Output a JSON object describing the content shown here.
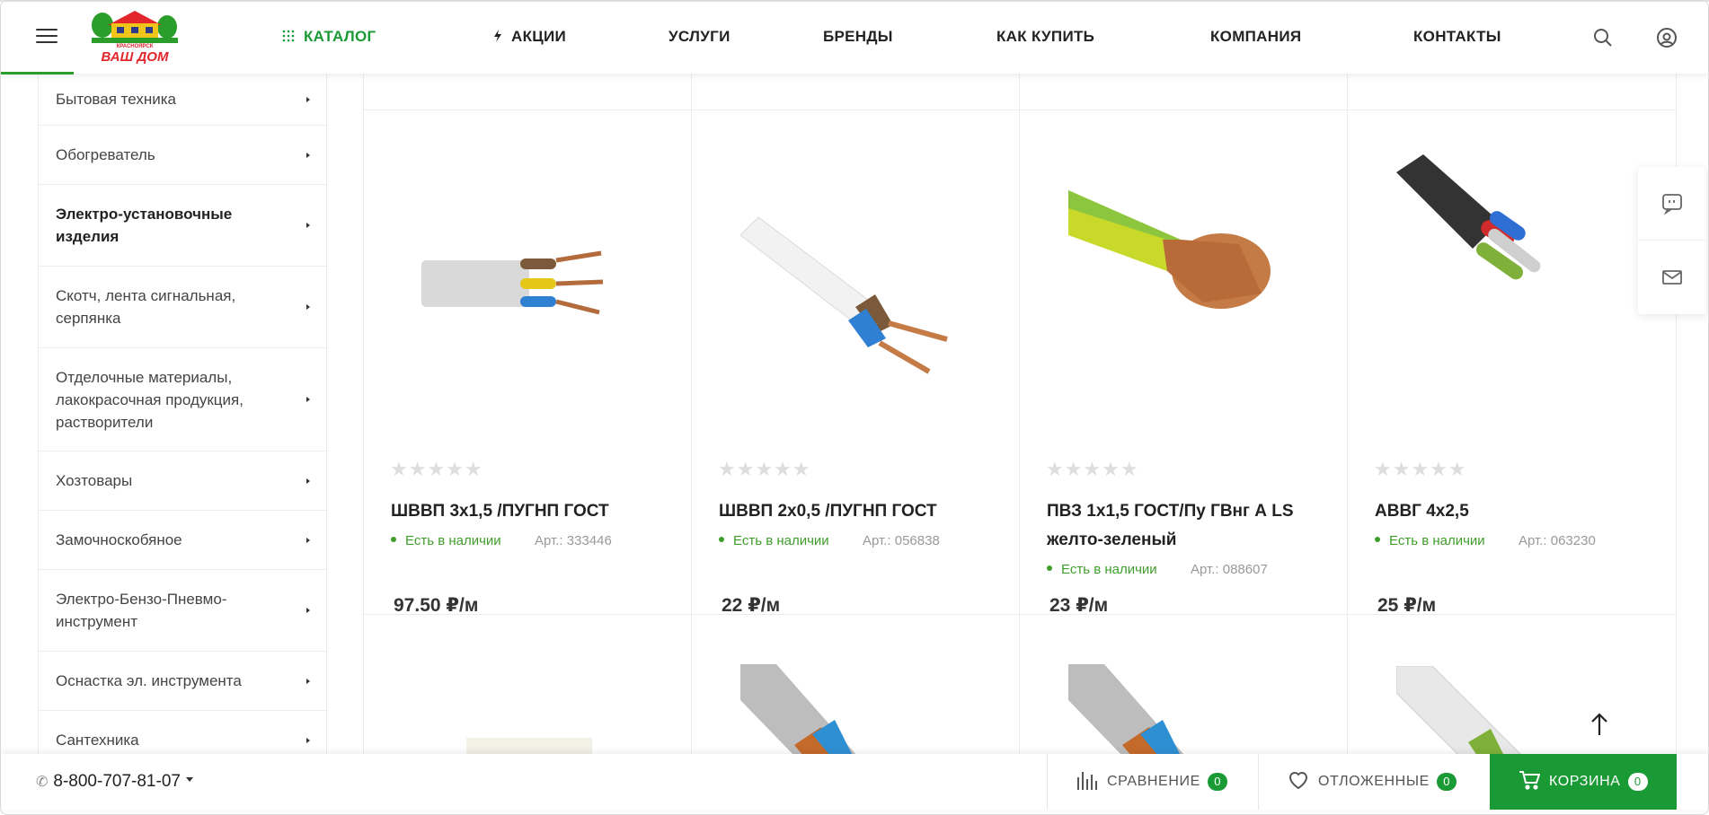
{
  "header": {
    "logo": {
      "city": "КРАСНОЯРСК",
      "brand": "ВАШ ДОМ",
      "colors": {
        "green": "#2a9d2a",
        "yellow": "#f0c419",
        "red": "#e3262c"
      }
    },
    "nav": [
      {
        "label": "КАТАЛОГ",
        "icon": "grid-dots-icon"
      },
      {
        "label": "АКЦИИ",
        "icon": "lightning-icon"
      },
      {
        "label": "УСЛУГИ"
      },
      {
        "label": "БРЕНДЫ"
      },
      {
        "label": "КАК КУПИТЬ"
      },
      {
        "label": "КОМПАНИЯ"
      },
      {
        "label": "КОНТАКТЫ"
      }
    ],
    "icons": [
      "menu-icon",
      "search-icon",
      "user-icon"
    ]
  },
  "sidebar": {
    "items": [
      {
        "label": "Бытовая техника"
      },
      {
        "label": "Обогреватель"
      },
      {
        "label": "Электро-установочные изделия",
        "bold": true
      },
      {
        "label": "Скотч, лента сигнальная, серпянка"
      },
      {
        "label": "Отделочные материалы, лакокрасочная продукция, растворители"
      },
      {
        "label": "Хозтовары"
      },
      {
        "label": "Замочноскобяное"
      },
      {
        "label": "Электро-Бензо-Пневмо-инструмент"
      },
      {
        "label": "Оснастка эл. инструмента"
      },
      {
        "label": "Сантехника"
      }
    ]
  },
  "products": [
    {
      "name": "ШВВП 3х1,5 /ПУГНП ГОСТ",
      "availability": "Есть в наличии",
      "article": "Арт.: 333446",
      "price": "97.50 ₽/м",
      "rating": 0,
      "image": "cable-flat-3core-image"
    },
    {
      "name": "ШВВП 2х0,5 /ПУГНП ГОСТ",
      "availability": "Есть в наличии",
      "article": "Арт.: 056838",
      "price": "22 ₽/м",
      "rating": 0,
      "image": "cable-flat-2core-image"
    },
    {
      "name": "ПВЗ 1х1,5 ГОСТ/Пу ГВнг А LS желто-зеленый",
      "availability": "Есть в наличии",
      "article": "Арт.: 088607",
      "price": "23 ₽/м",
      "rating": 0,
      "image": "wire-yellow-green-image"
    },
    {
      "name": "АВВГ 4х2,5",
      "availability": "Есть в наличии",
      "article": "Арт.: 063230",
      "price": "25 ₽/м",
      "rating": 0,
      "image": "cable-black-4core-image"
    }
  ],
  "stars_glyph": "★★★★★",
  "bottom_bar": {
    "phone": "8-800-707-81-07",
    "compare": {
      "label": "СРАВНЕНИЕ",
      "count": "0"
    },
    "deferred": {
      "label": "ОТЛОЖЕННЫЕ",
      "count": "0"
    },
    "cart": {
      "label": "КОРЗИНА",
      "count": "0"
    }
  },
  "colors": {
    "accent": "#1a9a35",
    "in_stock": "#3f9e2a"
  }
}
